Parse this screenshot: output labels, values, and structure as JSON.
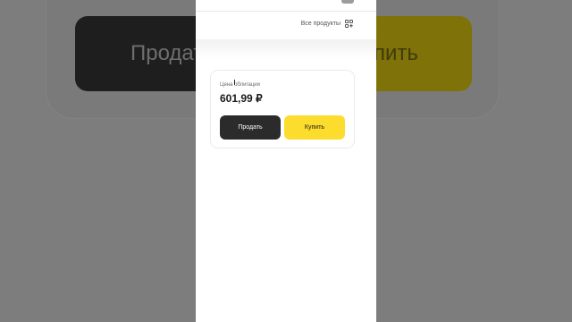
{
  "background": {
    "sell_text": "Продат",
    "buy_text": "пить"
  },
  "header": {
    "all_products_label": "Все продукты"
  },
  "bond": {
    "price_label": "Цена облигации",
    "price_value": "601,99 ₽",
    "sell_label": "Продать",
    "buy_label": "Купить"
  },
  "colors": {
    "sell": "#2b2b2b",
    "buy": "#fcdc2c"
  }
}
